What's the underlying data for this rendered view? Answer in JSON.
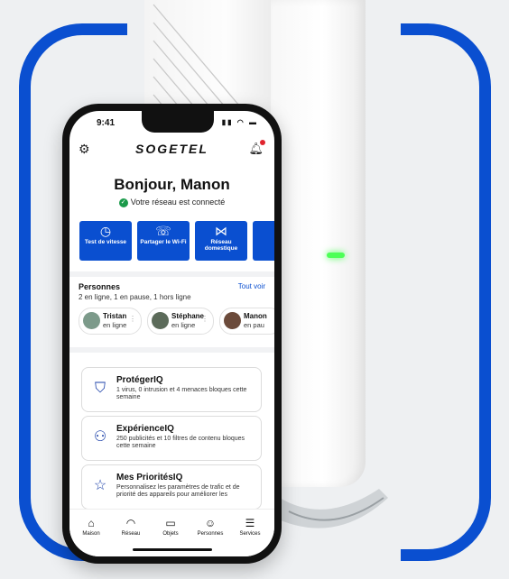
{
  "colors": {
    "brand_blue": "#0a4fd0",
    "led_green": "#4dff57",
    "connected_green": "#1a9a4a",
    "notification_red": "#e0242e"
  },
  "status_bar": {
    "time": "9:41",
    "icons": "signal-icon wifi-icon battery-icon"
  },
  "header": {
    "logo": "SOGETEL"
  },
  "greeting": "Bonjour, Manon",
  "network_status": "Votre réseau est connecté",
  "quick_actions": [
    {
      "icon": "speedometer-icon",
      "glyph": "◷",
      "label": "Test de vitesse"
    },
    {
      "icon": "share-wifi-icon",
      "glyph": "☏",
      "label": "Partager le Wi-Fi"
    },
    {
      "icon": "network-icon",
      "glyph": "⋈",
      "label": "Réseau domestique"
    },
    {
      "icon": "more-icon",
      "glyph": "",
      "label": ""
    }
  ],
  "people": {
    "title": "Personnes",
    "see_all": "Tout voir",
    "summary": "2 en ligne, 1 en pause, 1 hors ligne",
    "items": [
      {
        "name": "Tristan",
        "status": "en ligne"
      },
      {
        "name": "Stéphane",
        "status": "en ligne"
      },
      {
        "name": "Manon",
        "status": "en pau"
      }
    ]
  },
  "features": [
    {
      "icon": "shield-check-icon",
      "glyph": "⛉",
      "title": "ProtégerIQ",
      "desc": "1 virus, 0 intrusion et 4 menaces bloques cette semaine"
    },
    {
      "icon": "users-gear-icon",
      "glyph": "⚇",
      "title": "ExpérienceIQ",
      "desc": "250 publicités et 10 filtres de contenu bloques cette semaine"
    },
    {
      "icon": "star-box-icon",
      "glyph": "☆",
      "title": "Mes PrioritésIQ",
      "desc": "Personnalisez les paramètres de trafic et de priorité des appareils pour améliorer les"
    }
  ],
  "bottom_nav": [
    {
      "icon": "home-icon",
      "glyph": "⌂",
      "label": "Maison"
    },
    {
      "icon": "wifi-icon",
      "glyph": "◠",
      "label": "Réseau"
    },
    {
      "icon": "devices-icon",
      "glyph": "▭",
      "label": "Objets"
    },
    {
      "icon": "people-icon",
      "glyph": "☺",
      "label": "Personnes"
    },
    {
      "icon": "menu-icon",
      "glyph": "☰",
      "label": "Services"
    }
  ]
}
